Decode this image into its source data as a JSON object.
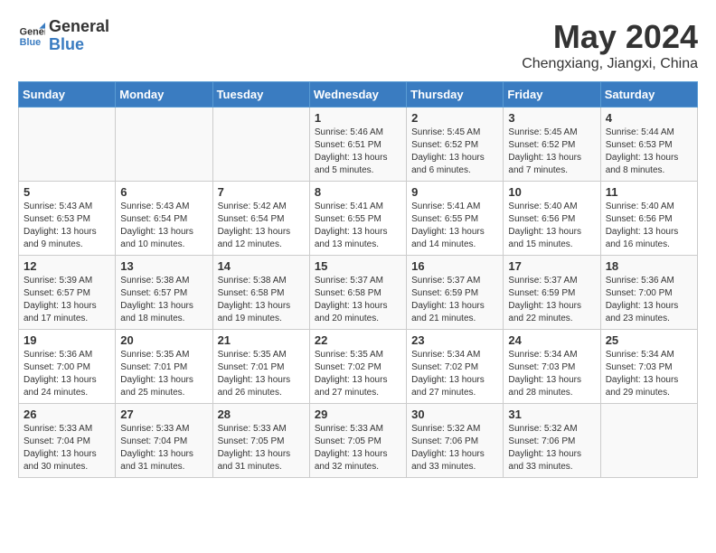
{
  "header": {
    "logo_line1": "General",
    "logo_line2": "Blue",
    "month_year": "May 2024",
    "location": "Chengxiang, Jiangxi, China"
  },
  "days_of_week": [
    "Sunday",
    "Monday",
    "Tuesday",
    "Wednesday",
    "Thursday",
    "Friday",
    "Saturday"
  ],
  "weeks": [
    [
      {
        "day": "",
        "info": ""
      },
      {
        "day": "",
        "info": ""
      },
      {
        "day": "",
        "info": ""
      },
      {
        "day": "1",
        "info": "Sunrise: 5:46 AM\nSunset: 6:51 PM\nDaylight: 13 hours and 5 minutes."
      },
      {
        "day": "2",
        "info": "Sunrise: 5:45 AM\nSunset: 6:52 PM\nDaylight: 13 hours and 6 minutes."
      },
      {
        "day": "3",
        "info": "Sunrise: 5:45 AM\nSunset: 6:52 PM\nDaylight: 13 hours and 7 minutes."
      },
      {
        "day": "4",
        "info": "Sunrise: 5:44 AM\nSunset: 6:53 PM\nDaylight: 13 hours and 8 minutes."
      }
    ],
    [
      {
        "day": "5",
        "info": "Sunrise: 5:43 AM\nSunset: 6:53 PM\nDaylight: 13 hours and 9 minutes."
      },
      {
        "day": "6",
        "info": "Sunrise: 5:43 AM\nSunset: 6:54 PM\nDaylight: 13 hours and 10 minutes."
      },
      {
        "day": "7",
        "info": "Sunrise: 5:42 AM\nSunset: 6:54 PM\nDaylight: 13 hours and 12 minutes."
      },
      {
        "day": "8",
        "info": "Sunrise: 5:41 AM\nSunset: 6:55 PM\nDaylight: 13 hours and 13 minutes."
      },
      {
        "day": "9",
        "info": "Sunrise: 5:41 AM\nSunset: 6:55 PM\nDaylight: 13 hours and 14 minutes."
      },
      {
        "day": "10",
        "info": "Sunrise: 5:40 AM\nSunset: 6:56 PM\nDaylight: 13 hours and 15 minutes."
      },
      {
        "day": "11",
        "info": "Sunrise: 5:40 AM\nSunset: 6:56 PM\nDaylight: 13 hours and 16 minutes."
      }
    ],
    [
      {
        "day": "12",
        "info": "Sunrise: 5:39 AM\nSunset: 6:57 PM\nDaylight: 13 hours and 17 minutes."
      },
      {
        "day": "13",
        "info": "Sunrise: 5:38 AM\nSunset: 6:57 PM\nDaylight: 13 hours and 18 minutes."
      },
      {
        "day": "14",
        "info": "Sunrise: 5:38 AM\nSunset: 6:58 PM\nDaylight: 13 hours and 19 minutes."
      },
      {
        "day": "15",
        "info": "Sunrise: 5:37 AM\nSunset: 6:58 PM\nDaylight: 13 hours and 20 minutes."
      },
      {
        "day": "16",
        "info": "Sunrise: 5:37 AM\nSunset: 6:59 PM\nDaylight: 13 hours and 21 minutes."
      },
      {
        "day": "17",
        "info": "Sunrise: 5:37 AM\nSunset: 6:59 PM\nDaylight: 13 hours and 22 minutes."
      },
      {
        "day": "18",
        "info": "Sunrise: 5:36 AM\nSunset: 7:00 PM\nDaylight: 13 hours and 23 minutes."
      }
    ],
    [
      {
        "day": "19",
        "info": "Sunrise: 5:36 AM\nSunset: 7:00 PM\nDaylight: 13 hours and 24 minutes."
      },
      {
        "day": "20",
        "info": "Sunrise: 5:35 AM\nSunset: 7:01 PM\nDaylight: 13 hours and 25 minutes."
      },
      {
        "day": "21",
        "info": "Sunrise: 5:35 AM\nSunset: 7:01 PM\nDaylight: 13 hours and 26 minutes."
      },
      {
        "day": "22",
        "info": "Sunrise: 5:35 AM\nSunset: 7:02 PM\nDaylight: 13 hours and 27 minutes."
      },
      {
        "day": "23",
        "info": "Sunrise: 5:34 AM\nSunset: 7:02 PM\nDaylight: 13 hours and 27 minutes."
      },
      {
        "day": "24",
        "info": "Sunrise: 5:34 AM\nSunset: 7:03 PM\nDaylight: 13 hours and 28 minutes."
      },
      {
        "day": "25",
        "info": "Sunrise: 5:34 AM\nSunset: 7:03 PM\nDaylight: 13 hours and 29 minutes."
      }
    ],
    [
      {
        "day": "26",
        "info": "Sunrise: 5:33 AM\nSunset: 7:04 PM\nDaylight: 13 hours and 30 minutes."
      },
      {
        "day": "27",
        "info": "Sunrise: 5:33 AM\nSunset: 7:04 PM\nDaylight: 13 hours and 31 minutes."
      },
      {
        "day": "28",
        "info": "Sunrise: 5:33 AM\nSunset: 7:05 PM\nDaylight: 13 hours and 31 minutes."
      },
      {
        "day": "29",
        "info": "Sunrise: 5:33 AM\nSunset: 7:05 PM\nDaylight: 13 hours and 32 minutes."
      },
      {
        "day": "30",
        "info": "Sunrise: 5:32 AM\nSunset: 7:06 PM\nDaylight: 13 hours and 33 minutes."
      },
      {
        "day": "31",
        "info": "Sunrise: 5:32 AM\nSunset: 7:06 PM\nDaylight: 13 hours and 33 minutes."
      },
      {
        "day": "",
        "info": ""
      }
    ]
  ]
}
